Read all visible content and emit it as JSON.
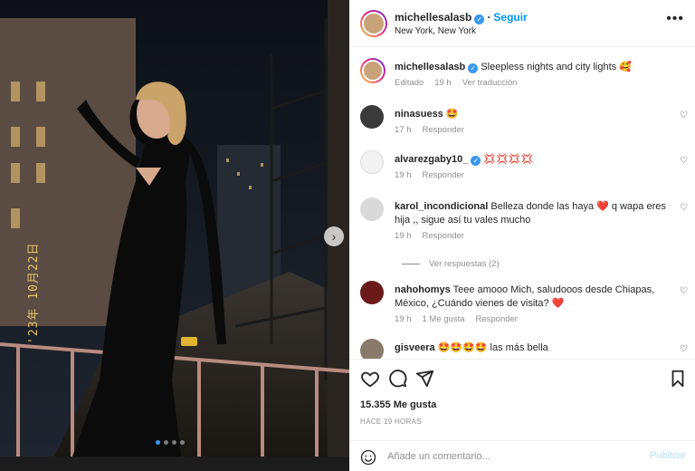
{
  "header": {
    "username": "michellesalasb",
    "follow_label": "Seguir",
    "location": "New York, New York",
    "more_icon": "more-horizontal-icon"
  },
  "photo": {
    "date_stamp": "'23年 10月22日",
    "slide_count": 4,
    "active_slide": 1
  },
  "caption": {
    "username": "michellesalasb",
    "text": "Sleepless nights and city lights 🥰",
    "edited": "Editado",
    "time": "19 h",
    "translate": "Ver traducción"
  },
  "comments": [
    {
      "username": "ninasuess",
      "text": "🤩",
      "time": "17 h",
      "likes": "",
      "reply": "Responder"
    },
    {
      "username": "alvarezgaby10_",
      "text": "💢💢💢💢",
      "time": "19 h",
      "likes": "",
      "reply": "Responder"
    },
    {
      "username": "karol_incondicional",
      "text": "Belleza donde las haya ❤️ q wapa eres hija ,, sigue así tu vales mucho",
      "time": "19 h",
      "likes": "",
      "reply": "Responder",
      "replies_label": "Ver respuestas (2)"
    },
    {
      "username": "nahohomys",
      "text": "Teee amooo Mich, saludooos desde Chiapas, México, ¿Cuándo vienes de visita? ❤️",
      "time": "19 h",
      "likes": "1 Me gusta",
      "reply": "Responder"
    },
    {
      "username": "gisveera",
      "text": "🤩🤩🤩🤩 las más bella",
      "time": "",
      "likes": "",
      "reply": ""
    }
  ],
  "actions": {
    "likes": "15.355 Me gusta",
    "ago": "HACE 19 HORAS"
  },
  "add_comment": {
    "placeholder": "Añade un comentario...",
    "publish_label": "Publicar"
  },
  "colors": {
    "accent": "#0095f6",
    "verified": "#3897f0",
    "muted": "#8e8e8e",
    "heart_red": "#ed4956"
  }
}
